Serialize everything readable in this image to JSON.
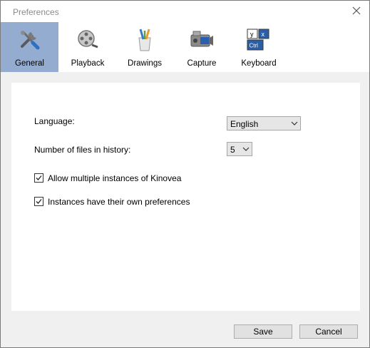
{
  "window": {
    "title": "Preferences"
  },
  "tabs": [
    {
      "label": "General",
      "icon": "tools-icon",
      "active": true
    },
    {
      "label": "Playback",
      "icon": "film-reel-icon",
      "active": false
    },
    {
      "label": "Drawings",
      "icon": "pens-icon",
      "active": false
    },
    {
      "label": "Capture",
      "icon": "camcorder-icon",
      "active": false
    },
    {
      "label": "Keyboard",
      "icon": "keyboard-keys-icon",
      "active": false
    }
  ],
  "general": {
    "language_label": "Language:",
    "language_value": "English",
    "history_label": "Number of files in history:",
    "history_value": "5",
    "allow_multiple_label": "Allow multiple instances of Kinovea",
    "allow_multiple_checked": true,
    "own_prefs_label": "Instances have their own preferences",
    "own_prefs_checked": true
  },
  "buttons": {
    "save": "Save",
    "cancel": "Cancel"
  },
  "colors": {
    "active_tab": "#93acd0",
    "panel": "#ffffff",
    "background": "#f0f0f0"
  }
}
